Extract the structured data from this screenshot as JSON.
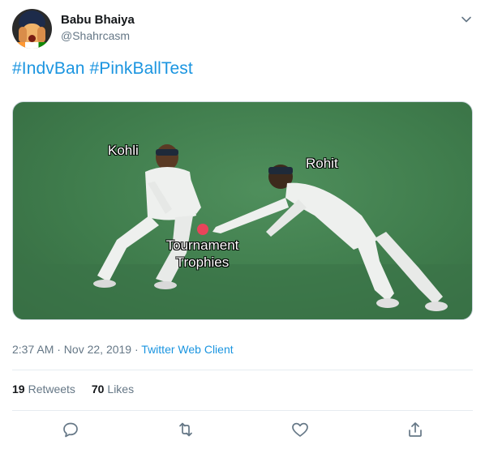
{
  "user": {
    "display_name": "Babu Bhaiya",
    "handle": "@Shahrcasm"
  },
  "tweet": {
    "hashtags": [
      "#IndvBan",
      "#PinkBallTest"
    ]
  },
  "media": {
    "labels": {
      "left_player": "Kohli",
      "right_player": "Rohit",
      "ball_line1": "Tournament",
      "ball_line2": "Trophies"
    }
  },
  "meta": {
    "timestamp": "2:37 AM · Nov 22, 2019",
    "separator": " · ",
    "client": "Twitter Web Client"
  },
  "stats": {
    "retweets_count": "19",
    "retweets_label": "Retweets",
    "likes_count": "70",
    "likes_label": "Likes"
  },
  "icons": {
    "caret": "chevron-down-icon",
    "reply": "reply-icon",
    "retweet": "retweet-icon",
    "like": "heart-icon",
    "share": "share-icon"
  },
  "colors": {
    "link": "#1b95e0",
    "secondary_text": "#657786",
    "primary_text": "#14171a",
    "pitch": "#3f7c4c"
  }
}
